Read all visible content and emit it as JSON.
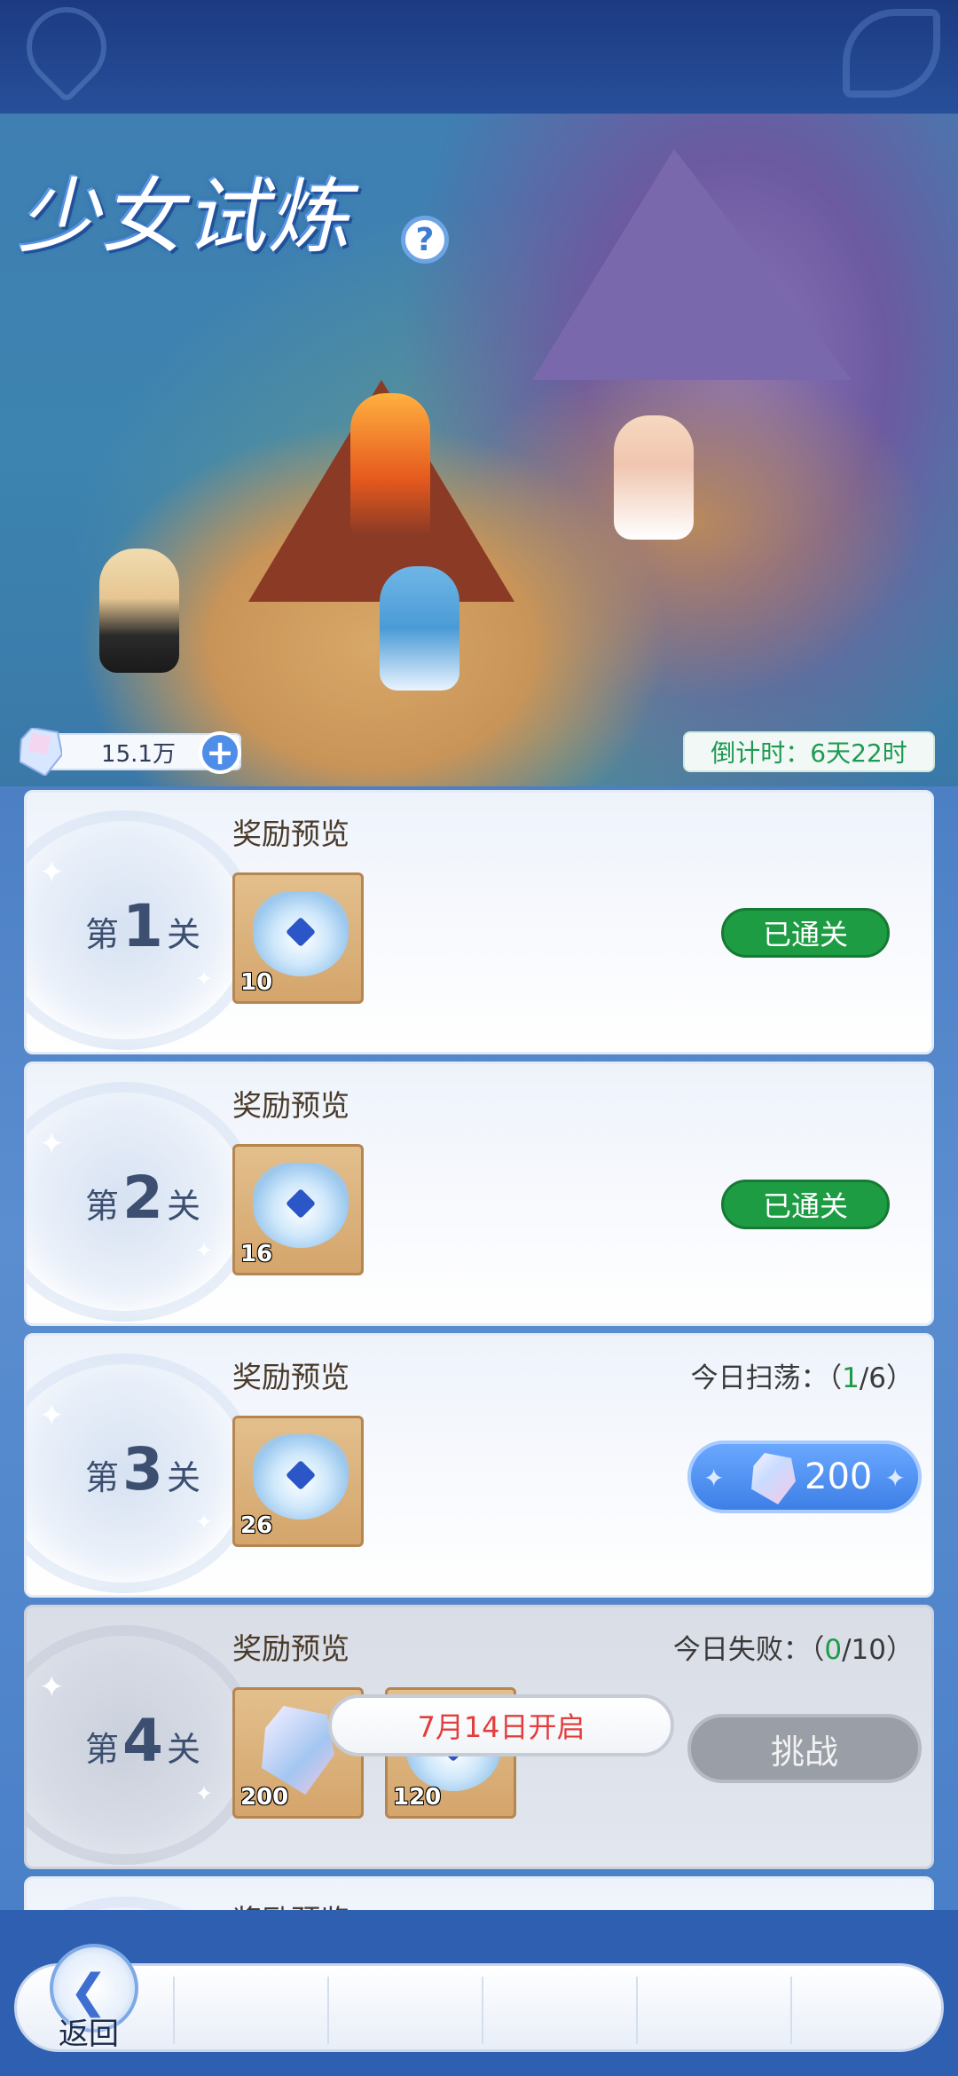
{
  "header": {
    "title": "少女试炼",
    "help_icon": "question-icon"
  },
  "currency": {
    "icon": "crystal-icon",
    "amount": "15.1万",
    "add_icon": "plus-icon"
  },
  "countdown": {
    "label": "倒计时：",
    "value": "6天22时"
  },
  "stages": [
    {
      "prefix": "第",
      "number": "1",
      "suffix": "关",
      "reward_title": "奖励预览",
      "rewards": [
        {
          "icon": "dragon-gem-icon",
          "qty": "10"
        }
      ],
      "status": "已通关"
    },
    {
      "prefix": "第",
      "number": "2",
      "suffix": "关",
      "reward_title": "奖励预览",
      "rewards": [
        {
          "icon": "dragon-gem-icon",
          "qty": "16"
        }
      ],
      "status": "已通关"
    },
    {
      "prefix": "第",
      "number": "3",
      "suffix": "关",
      "reward_title": "奖励预览",
      "rewards": [
        {
          "icon": "dragon-gem-icon",
          "qty": "26"
        }
      ],
      "sweep_label": "今日扫荡：",
      "sweep_open": "（",
      "sweep_used": "1",
      "sweep_total": "/6）",
      "sweep_cost": "200",
      "sweep_cost_icon": "crystal-icon"
    },
    {
      "prefix": "第",
      "number": "4",
      "suffix": "关",
      "reward_title": "奖励预览",
      "rewards": [
        {
          "icon": "crystal-icon",
          "qty": "200"
        },
        {
          "icon": "dragon-gem-icon",
          "qty": "120"
        }
      ],
      "fail_label": "今日失败：",
      "fail_open": "（",
      "fail_used": "0",
      "fail_total": "/10）",
      "unlock_text": "7月14日开启",
      "challenge_label": "挑战"
    },
    {
      "reward_title": "奖励预览"
    }
  ],
  "footer": {
    "back_label": "返回",
    "back_icon": "back-arrow-icon"
  }
}
